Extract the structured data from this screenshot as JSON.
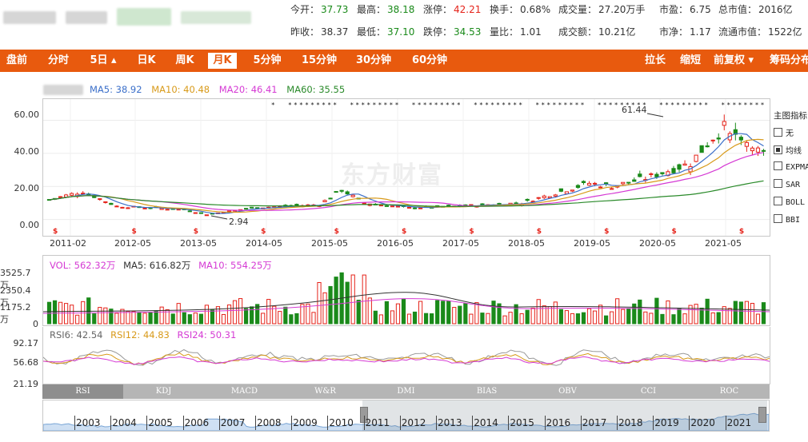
{
  "header": {
    "quotes": [
      {
        "label": "今开：",
        "value": "37.73",
        "tone": "green"
      },
      {
        "label": "最高：",
        "value": "38.18",
        "tone": "green"
      },
      {
        "label": "涨停：",
        "value": "42.21",
        "tone": "red"
      },
      {
        "label": "换手：",
        "value": "0.68%",
        "tone": "plain"
      },
      {
        "label": "成交量：",
        "value": "27.20万手",
        "tone": "plain"
      },
      {
        "label": "市盈：",
        "value": "6.75",
        "tone": "plain"
      },
      {
        "label": "总市值：",
        "value": "2016亿",
        "tone": "plain"
      },
      {
        "label": "昨收：",
        "value": "38.37",
        "tone": "plain"
      },
      {
        "label": "最低：",
        "value": "37.10",
        "tone": "green"
      },
      {
        "label": "跌停：",
        "value": "34.53",
        "tone": "green"
      },
      {
        "label": "量比：",
        "value": "1.01",
        "tone": "plain"
      },
      {
        "label": "成交额：",
        "value": "10.21亿",
        "tone": "plain"
      },
      {
        "label": "市净：",
        "value": "1.17",
        "tone": "plain"
      },
      {
        "label": "流通市值：",
        "value": "1522亿",
        "tone": "plain"
      }
    ]
  },
  "toolbar": {
    "left_tabs": [
      "盘前",
      "分时",
      "5日 ▴",
      "日K",
      "周K",
      "月K",
      "5分钟",
      "15分钟",
      "30分钟",
      "60分钟"
    ],
    "active_tab": "月K",
    "right_tabs": [
      "拉长",
      "缩短",
      "前复权 ▾",
      "筹码分布"
    ]
  },
  "price_chart": {
    "legend": [
      {
        "text": "MA5: 38.92",
        "color": "#3b6fc9"
      },
      {
        "text": "MA10: 40.48",
        "color": "#d89a1a"
      },
      {
        "text": "MA20: 46.41",
        "color": "#d53ad4"
      },
      {
        "text": "MA60: 35.55",
        "color": "#2a8a2a"
      }
    ],
    "y_ticks": [
      "60.00",
      "40.00",
      "20.00",
      "0.00"
    ],
    "x_ticks": [
      "2011-02",
      "2012-05",
      "2013-05",
      "2014-05",
      "2015-05",
      "2016-05",
      "2017-05",
      "2018-05",
      "2019-05",
      "2020-05",
      "2021-05"
    ],
    "high_annotation": "61.44",
    "low_annotation": "2.94",
    "watermark": "东方财富",
    "indicator_panel": {
      "title": "主图指标",
      "options": [
        {
          "label": "无",
          "checked": false
        },
        {
          "label": "均线",
          "checked": true
        },
        {
          "label": "EXPMA",
          "checked": false
        },
        {
          "label": "SAR",
          "checked": false
        },
        {
          "label": "BOLL",
          "checked": false
        },
        {
          "label": "BBI",
          "checked": false
        }
      ]
    }
  },
  "volume_chart": {
    "legend": [
      {
        "text": "VOL: 562.32万",
        "color": "#d53ad4"
      },
      {
        "text": "MA5: 616.82万",
        "color": "#333333"
      },
      {
        "text": "MA10: 554.25万",
        "color": "#d53ad4"
      }
    ],
    "y_ticks": [
      "3525.7万",
      "2350.4万",
      "1175.2万",
      "0"
    ]
  },
  "rsi_chart": {
    "legend": [
      {
        "text": "RSI6: 42.54",
        "color": "#666666"
      },
      {
        "text": "RSI12: 44.83",
        "color": "#d89a1a"
      },
      {
        "text": "RSI24: 50.31",
        "color": "#d53ad4"
      }
    ],
    "y_ticks": [
      "92.17",
      "56.68",
      "21.19"
    ]
  },
  "indicator_tabs": {
    "tabs": [
      "RSI",
      "KDJ",
      "MACD",
      "W&R",
      "DMI",
      "BIAS",
      "OBV",
      "CCI",
      "ROC"
    ],
    "active": "RSI"
  },
  "navigator": {
    "years": [
      "2003",
      "2004",
      "2005",
      "2006",
      "2007",
      "2008",
      "2009",
      "2010",
      "2011",
      "2012",
      "2013",
      "2014",
      "2015",
      "2016",
      "2017",
      "2018",
      "2019",
      "2020",
      "2021"
    ]
  },
  "colors": {
    "up": "#e5231a",
    "down": "#1a8a1a",
    "toolbar": "#e85a0e",
    "ma5": "#3b6fc9",
    "ma10": "#d89a1a",
    "ma20": "#d53ad4",
    "ma60": "#2a8a2a"
  }
}
